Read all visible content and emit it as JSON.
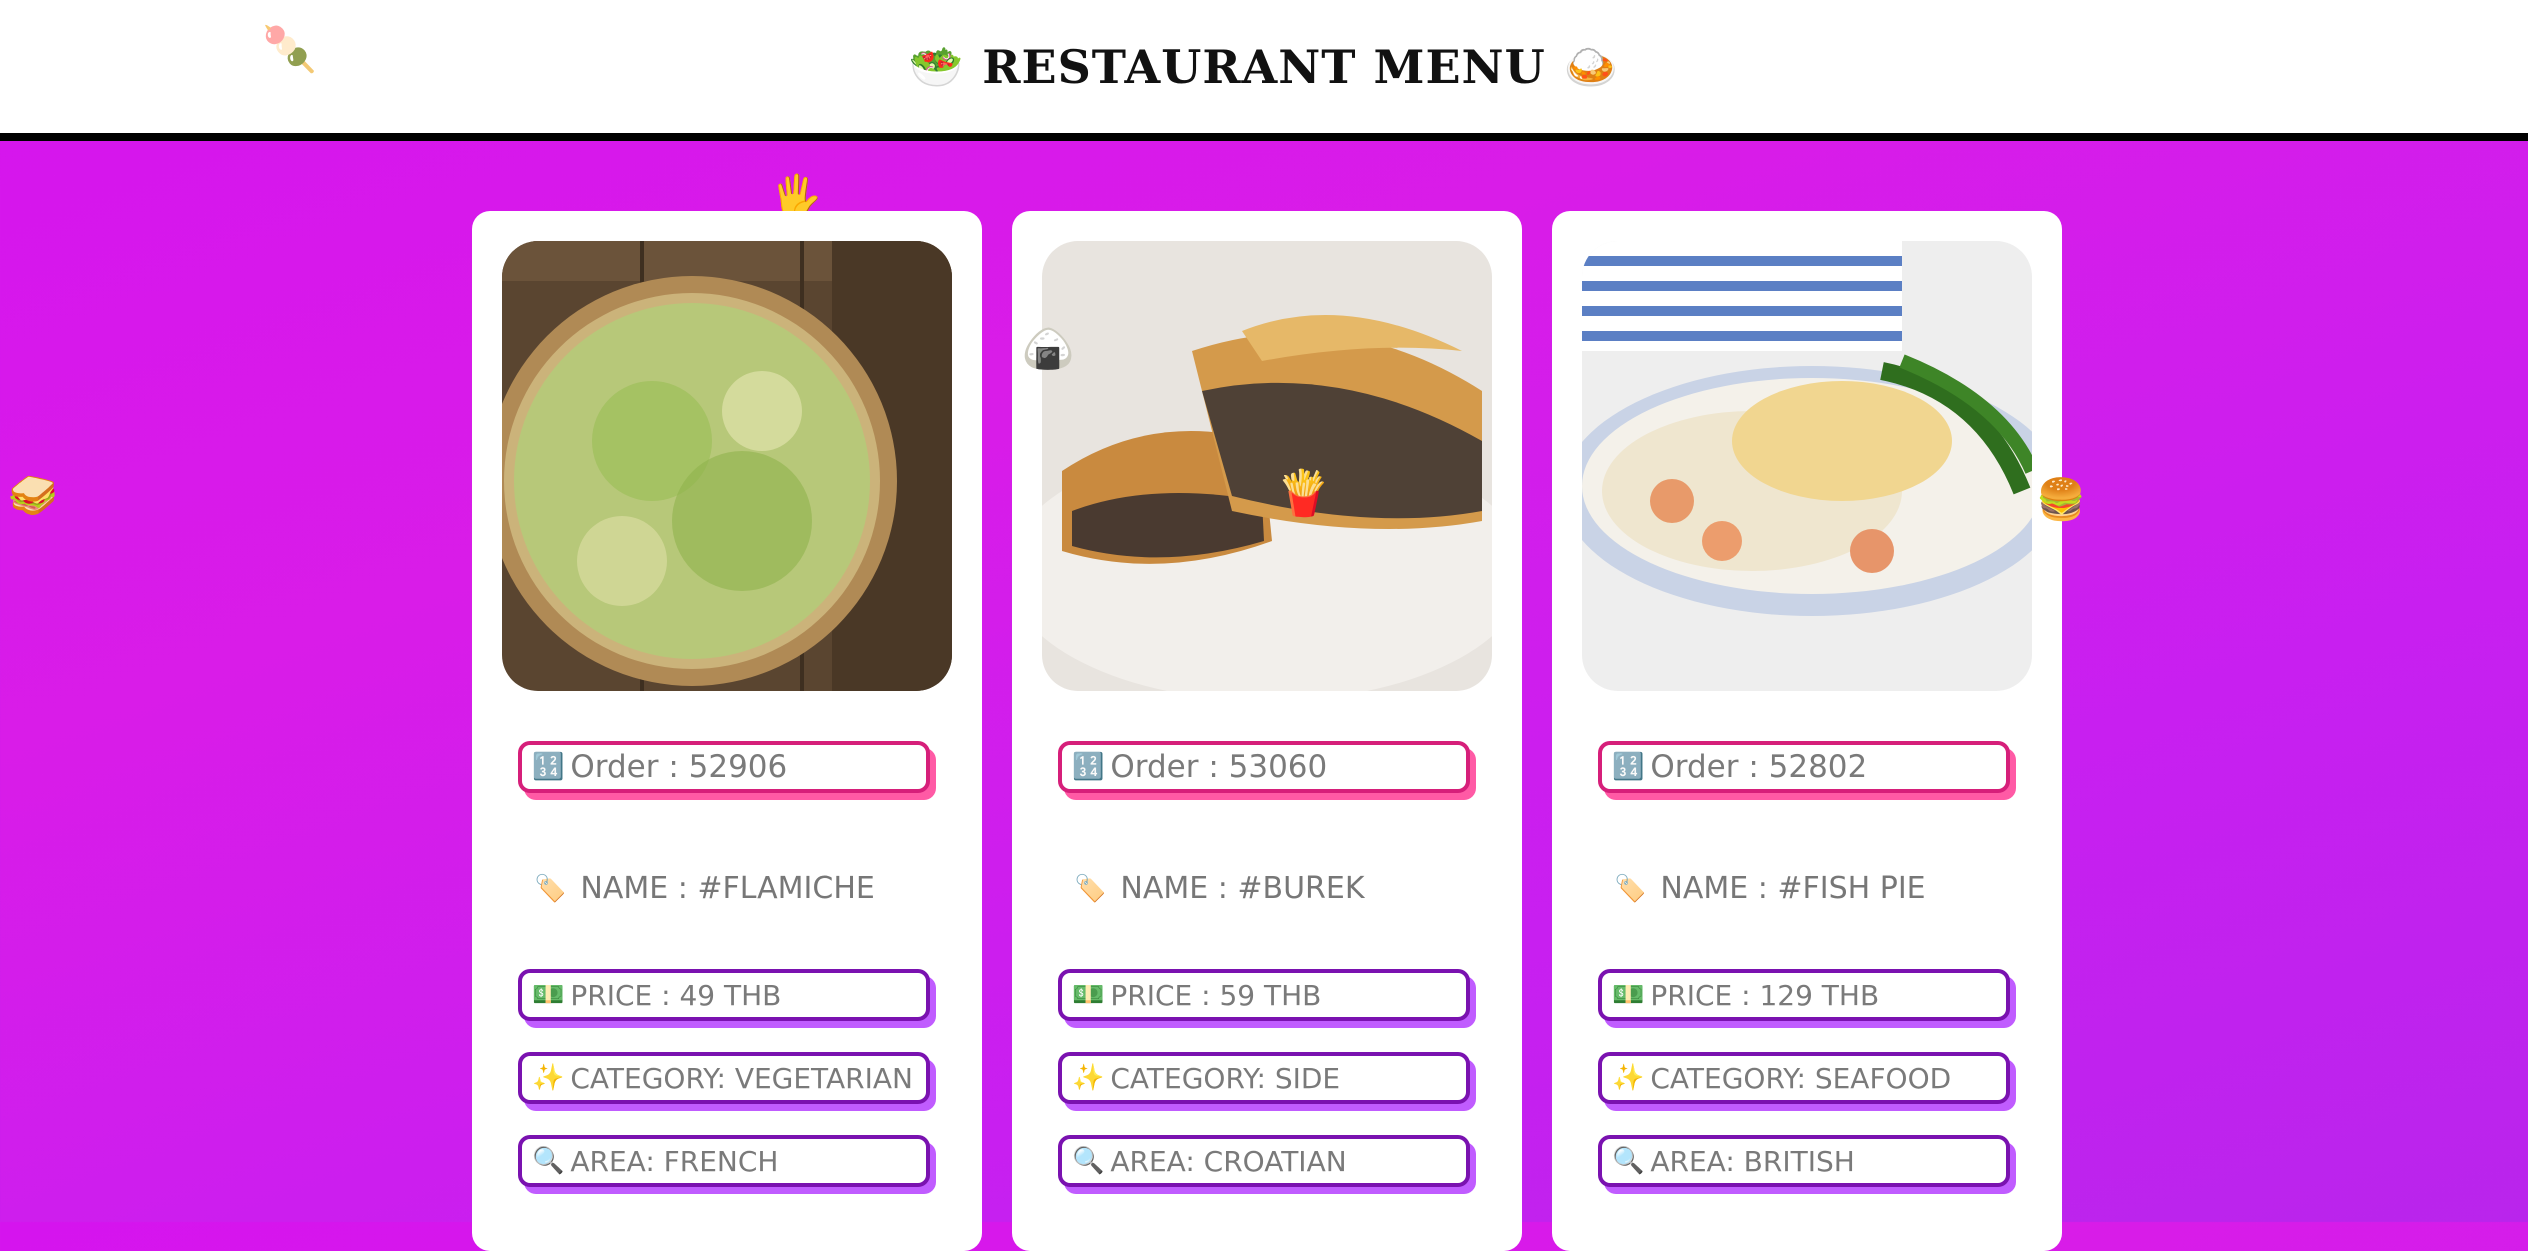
{
  "header": {
    "title": "RESTAURANT MENU",
    "left_emoji": "🥗",
    "right_emoji": "🍛"
  },
  "decorations": {
    "skewer": "🍡",
    "hand": "🖐",
    "sandwich": "🥪",
    "riceball": "🍙",
    "fries": "🍟",
    "burger": "🍔"
  },
  "icons": {
    "order": "🔢",
    "tag": "🏷️",
    "price": "💵",
    "category": "✨",
    "area": "🔍"
  },
  "labels": {
    "order_prefix": "Order : ",
    "name_prefix": "NAME : #",
    "price_prefix": "PRICE : ",
    "category_prefix": "CATEGORY: ",
    "area_prefix": "AREA: "
  },
  "items": [
    {
      "order": "Order : 52906",
      "name": "NAME : #FLAMICHE",
      "price": "PRICE : 49 THB",
      "category": "CATEGORY: VEGETARIAN",
      "area": "AREA: FRENCH",
      "image": "flamiche-photo"
    },
    {
      "order": "Order : 53060",
      "name": "NAME : #BUREK",
      "price": "PRICE : 59 THB",
      "category": "CATEGORY: SIDE",
      "area": "AREA: CROATIAN",
      "image": "burek-photo"
    },
    {
      "order": "Order : 52802",
      "name": "NAME : #FISH PIE",
      "price": "PRICE : 129 THB",
      "category": "CATEGORY: SEAFOOD",
      "area": "AREA: BRITISH",
      "image": "fish-pie-photo"
    }
  ],
  "colors": {
    "background": "#d514ee",
    "order_border": "#d61f7a",
    "order_shadow": "#ff5aa5",
    "pill_border": "#7a12b0",
    "pill_shadow": "#c05cff"
  }
}
